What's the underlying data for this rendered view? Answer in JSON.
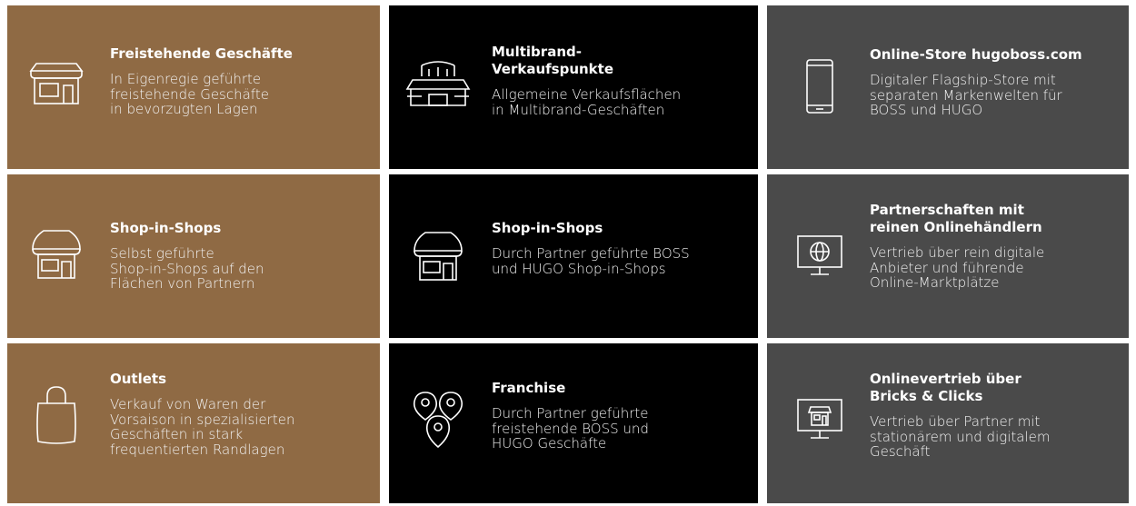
{
  "tiles": [
    {
      "icon": "storefront-icon",
      "title": "Freistehende Geschäfte",
      "desc": "In Eigenregie geführte\nfreistehende Geschäfte\nin bevorzugten Lagen"
    },
    {
      "icon": "department-store-icon",
      "title": "Multibrand-\nVerkaufspunkte",
      "desc": "Allgemeine Verkaufsflächen\nin Multibrand-Geschäften"
    },
    {
      "icon": "smartphone-icon",
      "title": "Online-Store hugoboss.com",
      "desc": "Digitaler Flagship-Store mit\nseparaten Markenwelten für\nBOSS und HUGO"
    },
    {
      "icon": "shop-awning-icon",
      "title": "Shop-in-Shops",
      "desc": "Selbst geführte\nShop-in-Shops auf den\nFlächen von Partnern"
    },
    {
      "icon": "shop-awning-icon",
      "title": "Shop-in-Shops",
      "desc": "Durch Partner geführte BOSS\nund HUGO Shop-in-Shops"
    },
    {
      "icon": "monitor-globe-icon",
      "title": "Partnerschaften mit\nreinen Onlinehändlern",
      "desc": "Vertrieb über rein digitale\nAnbieter und führende\nOnline-Marktplätze"
    },
    {
      "icon": "shopping-bag-icon",
      "title": "Outlets",
      "desc": "Verkauf von Waren der\nVorsaison in spezialisierten\nGeschäften in stark\nfrequentierten Randlagen"
    },
    {
      "icon": "location-pins-icon",
      "title": "Franchise",
      "desc": "Durch Partner geführte\nfreistehende BOSS und\nHUGO Geschäfte"
    },
    {
      "icon": "monitor-store-icon",
      "title": "Onlinevertrieb über\nBricks & Clicks",
      "desc": "Vertrieb über Partner mit\nstationärem und digitalem\nGeschäft"
    }
  ],
  "colors": {
    "brown": "#8f6a44",
    "black": "#000000",
    "grey": "#4a4a4a",
    "text": "#ffffff"
  }
}
